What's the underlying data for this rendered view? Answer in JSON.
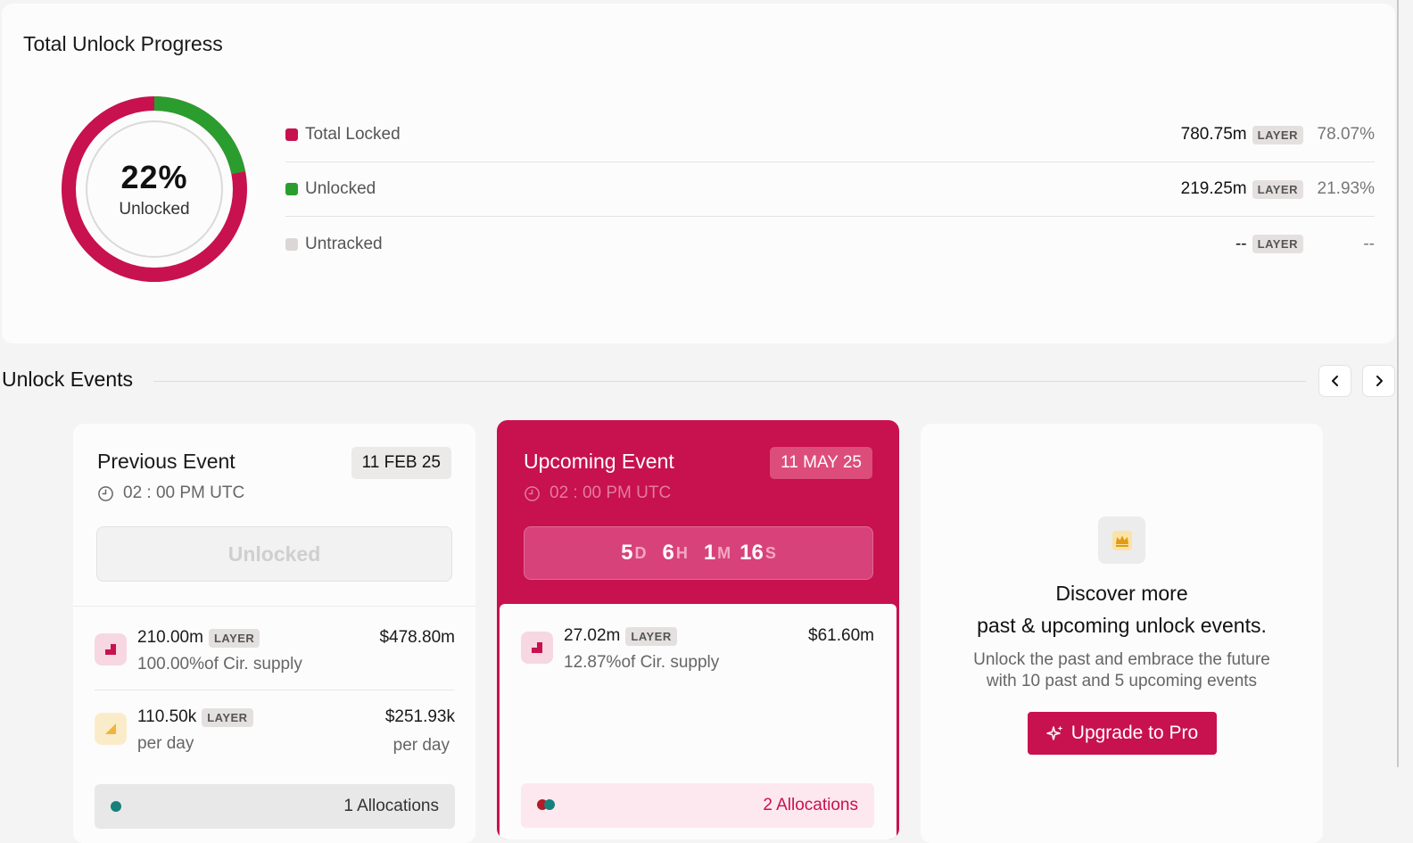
{
  "progress": {
    "title": "Total Unlock Progress",
    "percent_label": "22%",
    "percent_caption": "Unlocked",
    "unlocked_fraction": 0.2193,
    "rows": [
      {
        "label": "Total Locked",
        "amount": "780.75m",
        "token": "LAYER",
        "pct": "78.07%",
        "color": "#c8114f"
      },
      {
        "label": "Unlocked",
        "amount": "219.25m",
        "token": "LAYER",
        "pct": "21.93%",
        "color": "#2a9d2e"
      },
      {
        "label": "Untracked",
        "amount": "--",
        "token": "LAYER",
        "pct": "--",
        "color": "#dcd6d7"
      }
    ]
  },
  "events": {
    "title": "Unlock Events",
    "previous": {
      "title": "Previous Event",
      "date": "11 FEB 25",
      "time": "02 : 00 PM UTC",
      "status": "Unlocked",
      "stat1": {
        "amount": "210.00m",
        "token": "LAYER",
        "sub": "100.00%of Cir. supply",
        "usd": "$478.80m"
      },
      "stat2": {
        "amount": "110.50k",
        "token": "LAYER",
        "sub": "per day",
        "usd": "$251.93k",
        "usd_sub": "per day"
      },
      "allocations": "1 Allocations"
    },
    "upcoming": {
      "title": "Upcoming Event",
      "date": "11 MAY 25",
      "time": "02 : 00 PM UTC",
      "countdown": {
        "d": "5",
        "d_unit": "D",
        "h": "6",
        "h_unit": "H",
        "m": "1",
        "m_unit": "M",
        "s": "16",
        "s_unit": "S"
      },
      "stat1": {
        "amount": "27.02m",
        "token": "LAYER",
        "sub": "12.87%of Cir. supply",
        "usd": "$61.60m"
      },
      "allocations": "2 Allocations"
    },
    "promo": {
      "heading_line1": "Discover more",
      "heading_line2": "past & upcoming unlock events.",
      "body_line1": "Unlock the past and embrace the future",
      "body_line2": "with 10 past and 5 upcoming events",
      "button": "Upgrade to Pro"
    }
  }
}
